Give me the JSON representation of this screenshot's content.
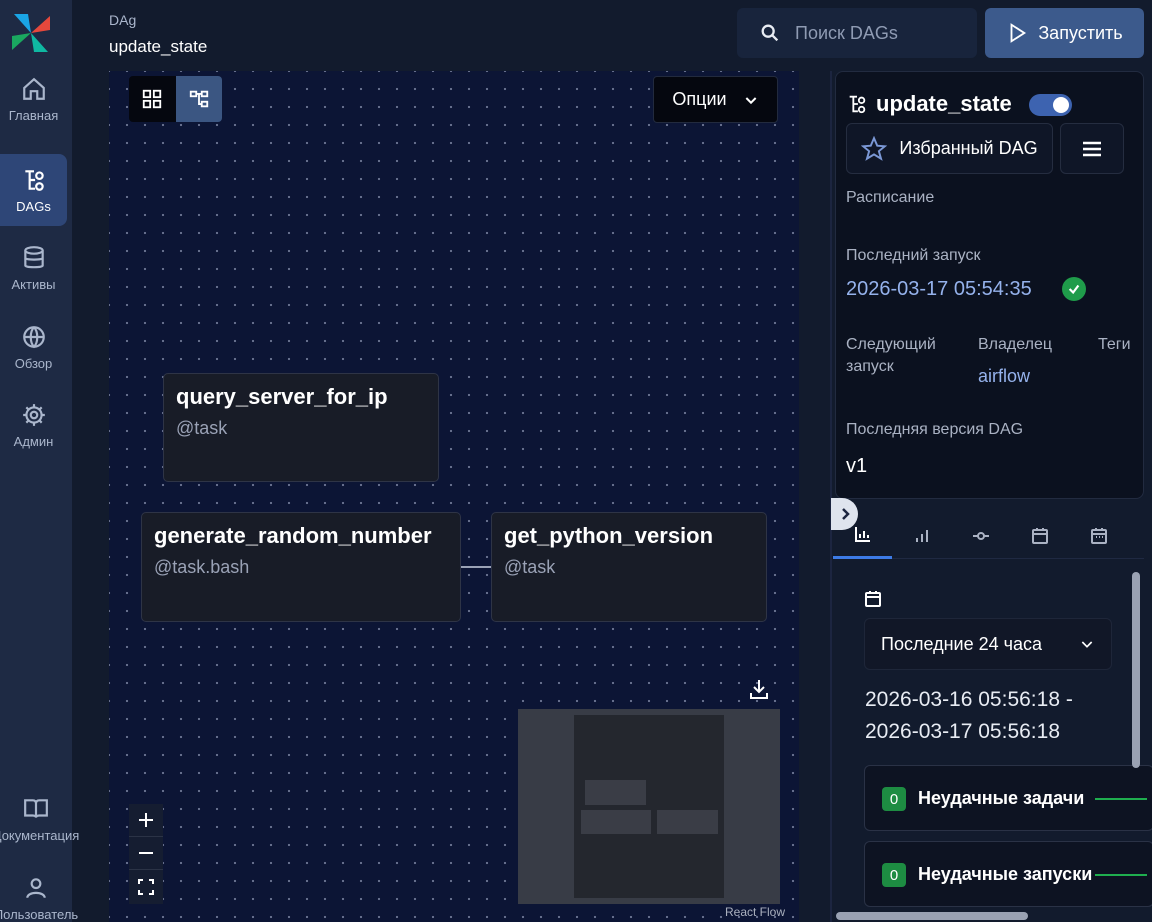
{
  "sidebar": {
    "items": [
      {
        "label": "Главная",
        "icon": "home-icon"
      },
      {
        "label": "DAGs",
        "icon": "dags-icon",
        "active": true
      },
      {
        "label": "Активы",
        "icon": "database-icon"
      },
      {
        "label": "Обзор",
        "icon": "globe-icon"
      },
      {
        "label": "Админ",
        "icon": "gear-icon"
      }
    ],
    "bottom": [
      {
        "label": "Документация",
        "icon": "book-icon"
      },
      {
        "label": "Пользователь",
        "icon": "user-icon"
      }
    ]
  },
  "header": {
    "breadcrumb_label": "DAg",
    "breadcrumb_title": "update_state",
    "search_placeholder": "Поиск DAGs",
    "run_label": "Запустить"
  },
  "graph": {
    "options_label": "Опции",
    "nodes": [
      {
        "title": "query_server_for_ip",
        "subtitle": "@task"
      },
      {
        "title": "generate_random_number",
        "subtitle": "@task.bash"
      },
      {
        "title": "get_python_version",
        "subtitle": "@task"
      }
    ],
    "minimap_label": "React Flow"
  },
  "details": {
    "dag_name": "update_state",
    "favorite_label": "Избранный DAG",
    "schedule_label": "Расписание",
    "last_run_label": "Последний запуск",
    "last_run_value": "2026-03-17 05:54:35",
    "next_run_label_1": "Следующий",
    "next_run_label_2": "запуск",
    "owner_label": "Владелец",
    "owner_value": "airflow",
    "tags_label": "Теги",
    "version_label": "Последняя версия DAG",
    "version_value": "v1"
  },
  "stats": {
    "range_select": "Последние 24 часа",
    "range_from": "2026-03-16 05:56:18 -",
    "range_to": "2026-03-17 05:56:18",
    "cards": [
      {
        "count": "0",
        "label": "Неудачные задачи"
      },
      {
        "count": "0",
        "label": "Неудачные запуски"
      }
    ]
  },
  "colors": {
    "sidebar_bg": "#1e2a44",
    "canvas_bg": "#0c1535",
    "accent": "#3d63b0",
    "success": "#1f9c4a",
    "link": "#95b2ec"
  }
}
